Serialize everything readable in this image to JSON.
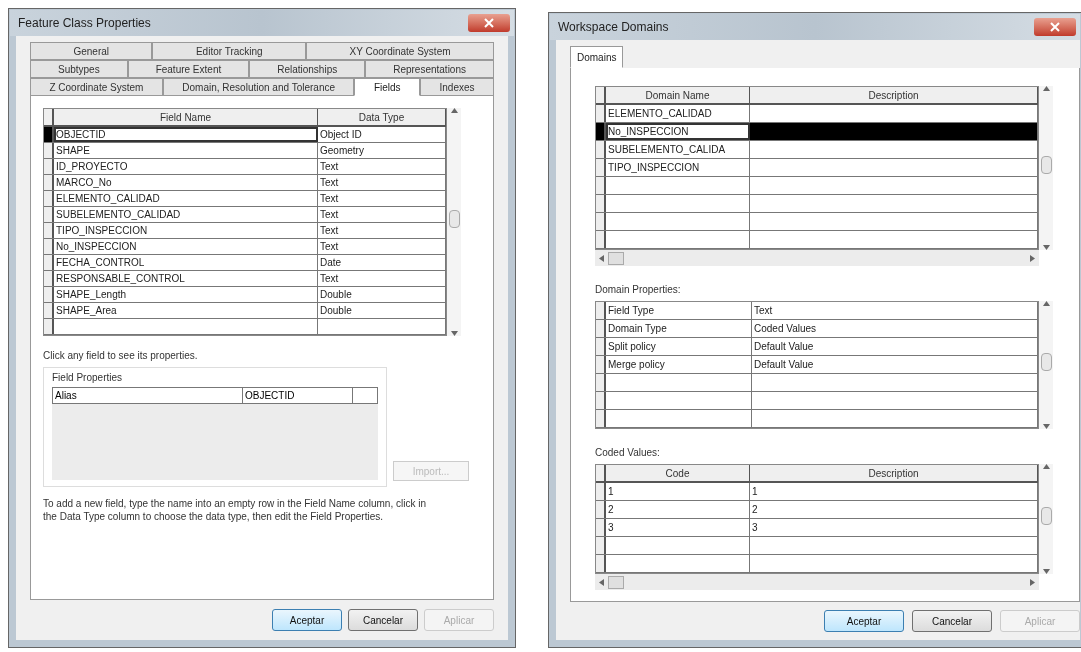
{
  "feature_class_window": {
    "title": "Feature Class Properties",
    "tab_rows": [
      [
        {
          "label": "General",
          "selected": false
        },
        {
          "label": "Editor Tracking",
          "selected": false
        },
        {
          "label": "XY Coordinate System",
          "selected": false
        }
      ],
      [
        {
          "label": "Subtypes",
          "selected": false
        },
        {
          "label": "Feature Extent",
          "selected": false
        },
        {
          "label": "Relationships",
          "selected": false
        },
        {
          "label": "Representations",
          "selected": false
        }
      ],
      [
        {
          "label": "Z Coordinate System",
          "selected": false
        },
        {
          "label": "Domain, Resolution and Tolerance",
          "selected": false
        },
        {
          "label": "Fields",
          "selected": true
        },
        {
          "label": "Indexes",
          "selected": false
        }
      ]
    ],
    "fields_table": {
      "columns": [
        "Field Name",
        "Data Type"
      ],
      "rows": [
        {
          "field_name": "OBJECTID",
          "data_type": "Object ID",
          "selected": true
        },
        {
          "field_name": "SHAPE",
          "data_type": "Geometry",
          "selected": false
        },
        {
          "field_name": "ID_PROYECTO",
          "data_type": "Text",
          "selected": false
        },
        {
          "field_name": "MARCO_No",
          "data_type": "Text",
          "selected": false
        },
        {
          "field_name": "ELEMENTO_CALIDAD",
          "data_type": "Text",
          "selected": false
        },
        {
          "field_name": "SUBELEMENTO_CALIDAD",
          "data_type": "Text",
          "selected": false
        },
        {
          "field_name": "TIPO_INSPECCION",
          "data_type": "Text",
          "selected": false
        },
        {
          "field_name": "No_INSPECCION",
          "data_type": "Text",
          "selected": false
        },
        {
          "field_name": "FECHA_CONTROL",
          "data_type": "Date",
          "selected": false
        },
        {
          "field_name": "RESPONSABLE_CONTROL",
          "data_type": "Text",
          "selected": false
        },
        {
          "field_name": "SHAPE_Length",
          "data_type": "Double",
          "selected": false
        },
        {
          "field_name": "SHAPE_Area",
          "data_type": "Double",
          "selected": false
        }
      ]
    },
    "hint": "Click any field to see its properties.",
    "field_properties": {
      "title": "Field Properties",
      "rows": [
        {
          "name": "Alias",
          "value": "OBJECTID"
        }
      ]
    },
    "import_button": {
      "label": "Import...",
      "disabled": true
    },
    "instructions": "To add a new field, type the name into an empty row in the Field Name column, click in the Data Type column to choose the data type, then edit the Field Properties.",
    "buttons": [
      {
        "label": "Aceptar",
        "default": true,
        "disabled": false
      },
      {
        "label": "Cancelar",
        "default": false,
        "disabled": false
      },
      {
        "label": "Aplicar",
        "default": false,
        "disabled": true
      }
    ]
  },
  "workspace_domains_window": {
    "title": "Workspace Domains",
    "tabs": [
      {
        "label": "Domains",
        "selected": true
      }
    ],
    "domains_table": {
      "columns": [
        "Domain Name",
        "Description"
      ],
      "rows": [
        {
          "name": "ELEMENTO_CALIDAD",
          "description": "",
          "selected": false
        },
        {
          "name": "No_INSPECCION",
          "description": "",
          "selected": true
        },
        {
          "name": "SUBELEMENTO_CALIDA",
          "description": "",
          "selected": false
        },
        {
          "name": "TIPO_INSPECCION",
          "description": "",
          "selected": false
        }
      ]
    },
    "domain_properties": {
      "label": "Domain Properties:",
      "rows": [
        {
          "name": "Field Type",
          "value": "Text"
        },
        {
          "name": "Domain Type",
          "value": "Coded Values"
        },
        {
          "name": "Split policy",
          "value": "Default Value"
        },
        {
          "name": "Merge policy",
          "value": "Default Value"
        }
      ]
    },
    "coded_values": {
      "label": "Coded Values:",
      "columns": [
        "Code",
        "Description"
      ],
      "rows": [
        {
          "code": "1",
          "description": "1"
        },
        {
          "code": "2",
          "description": "2"
        },
        {
          "code": "3",
          "description": "3"
        }
      ]
    },
    "buttons": [
      {
        "label": "Aceptar",
        "default": true,
        "disabled": false
      },
      {
        "label": "Cancelar",
        "default": false,
        "disabled": false
      },
      {
        "label": "Aplicar",
        "default": false,
        "disabled": true
      }
    ]
  }
}
